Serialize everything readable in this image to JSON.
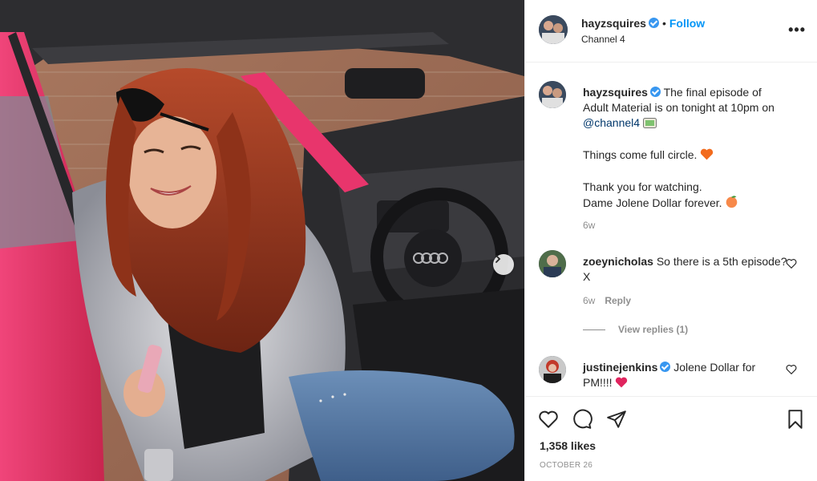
{
  "header": {
    "username": "hayzsquires",
    "follow_label": "Follow",
    "dot": "•",
    "subtitle": "Channel 4",
    "more_label": "•••"
  },
  "caption": {
    "username": "hayzsquires",
    "line1": "The final episode of Adult Material is on tonight at 10pm on ",
    "mention": "@channel4",
    "line2": "Things come full circle.",
    "line3": "Thank you for watching.",
    "line4": "Dame Jolene Dollar forever.",
    "time": "6w"
  },
  "comments": [
    {
      "username": "zoeynicholas",
      "text": "So there is a 5th episode? X",
      "time": "6w",
      "reply_label": "Reply",
      "view_replies": "View replies (1)"
    },
    {
      "username": "justinejenkins",
      "text": "Jolene Dollar for PM!!!! "
    }
  ],
  "footer": {
    "likes": "1,358 likes",
    "date": "OCTOBER 26"
  },
  "icons": [
    "heart-icon",
    "comment-icon",
    "share-icon",
    "bookmark-icon",
    "chevron-right-icon"
  ],
  "colors": {
    "follow": "#0095f6",
    "verified": "#3897f0",
    "muted": "#8e8e8e",
    "car": "#e8356c"
  }
}
